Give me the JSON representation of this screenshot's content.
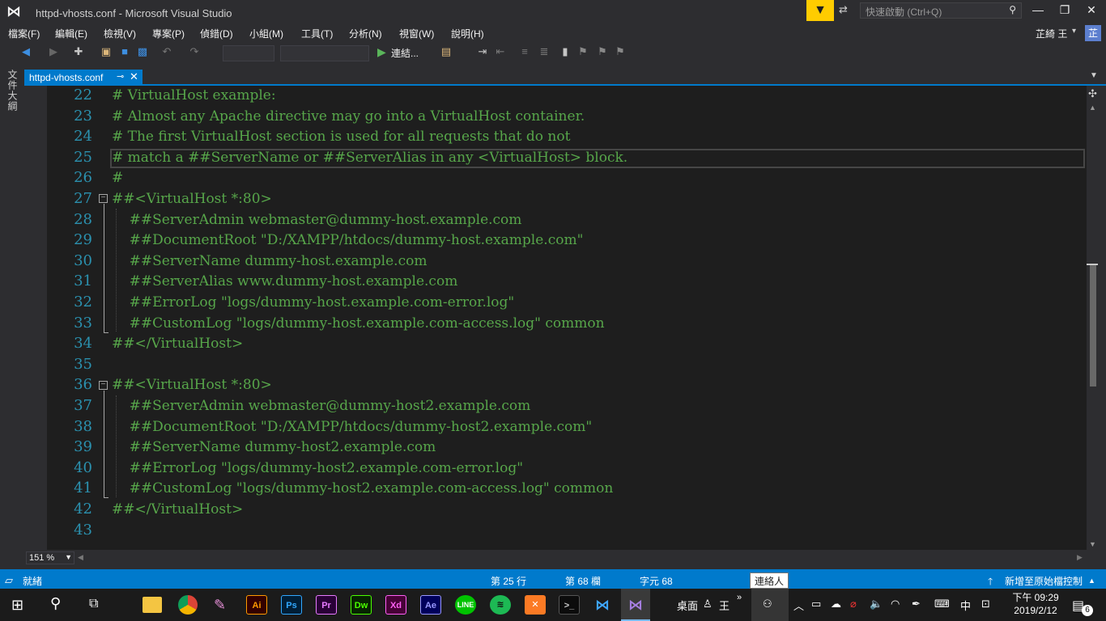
{
  "window": {
    "title": "httpd-vhosts.conf - Microsoft Visual Studio",
    "quick_launch_placeholder": "快速啟動 (Ctrl+Q)",
    "user_name": "芷綺 王",
    "user_initial": "芷"
  },
  "menu": [
    "檔案(F)",
    "編輯(E)",
    "檢視(V)",
    "專案(P)",
    "偵錯(D)",
    "小組(M)",
    "工具(T)",
    "分析(N)",
    "視窗(W)",
    "說明(H)"
  ],
  "toolbar": {
    "run_label": "連結..."
  },
  "side_panel": {
    "label": "文件大綱"
  },
  "tab": {
    "label": "httpd-vhosts.conf"
  },
  "editor": {
    "lines": [
      {
        "n": "22",
        "text": "# VirtualHost example:"
      },
      {
        "n": "23",
        "text": "# Almost any Apache directive may go into a VirtualHost container."
      },
      {
        "n": "24",
        "text": "# The first VirtualHost section is used for all requests that do not"
      },
      {
        "n": "25",
        "text": "# match a ##ServerName or ##ServerAlias in any <VirtualHost> block."
      },
      {
        "n": "26",
        "text": "#"
      },
      {
        "n": "27",
        "text": "##<VirtualHost *:80>"
      },
      {
        "n": "28",
        "text": "    ##ServerAdmin webmaster@dummy-host.example.com"
      },
      {
        "n": "29",
        "text": "    ##DocumentRoot \"D:/XAMPP/htdocs/dummy-host.example.com\""
      },
      {
        "n": "30",
        "text": "    ##ServerName dummy-host.example.com"
      },
      {
        "n": "31",
        "text": "    ##ServerAlias www.dummy-host.example.com"
      },
      {
        "n": "32",
        "text": "    ##ErrorLog \"logs/dummy-host.example.com-error.log\""
      },
      {
        "n": "33",
        "text": "    ##CustomLog \"logs/dummy-host.example.com-access.log\" common"
      },
      {
        "n": "34",
        "text": "##</VirtualHost>"
      },
      {
        "n": "35",
        "text": ""
      },
      {
        "n": "36",
        "text": "##<VirtualHost *:80>"
      },
      {
        "n": "37",
        "text": "    ##ServerAdmin webmaster@dummy-host2.example.com"
      },
      {
        "n": "38",
        "text": "    ##DocumentRoot \"D:/XAMPP/htdocs/dummy-host2.example.com\""
      },
      {
        "n": "39",
        "text": "    ##ServerName dummy-host2.example.com"
      },
      {
        "n": "40",
        "text": "    ##ErrorLog \"logs/dummy-host2.example.com-error.log\""
      },
      {
        "n": "41",
        "text": "    ##CustomLog \"logs/dummy-host2.example.com-access.log\" common"
      },
      {
        "n": "42",
        "text": "##</VirtualHost>"
      },
      {
        "n": "43",
        "text": ""
      }
    ],
    "zoom": "151 %"
  },
  "status": {
    "ready": "就緒",
    "line": "第 25 行",
    "col": "第 68 欄",
    "char": "字元 68",
    "contacts_tooltip": "連絡人",
    "publish": "新增至原始檔控制"
  },
  "taskbar": {
    "apps": [
      {
        "label": "Ai",
        "color": "#ff9a00",
        "bg": "#330000"
      },
      {
        "label": "Ps",
        "color": "#31a8ff",
        "bg": "#001e36"
      },
      {
        "label": "Pr",
        "color": "#e77bff",
        "bg": "#2a0037"
      },
      {
        "label": "Dw",
        "color": "#4aff00",
        "bg": "#072401"
      },
      {
        "label": "Xd",
        "color": "#ff61f6",
        "bg": "#470137"
      },
      {
        "label": "Ae",
        "color": "#9999ff",
        "bg": "#00005b"
      }
    ],
    "desktop_label": "桌面",
    "user_label": "王",
    "ime": "中",
    "time": "下午 09:29",
    "date": "2019/2/12",
    "notifications": "6"
  }
}
